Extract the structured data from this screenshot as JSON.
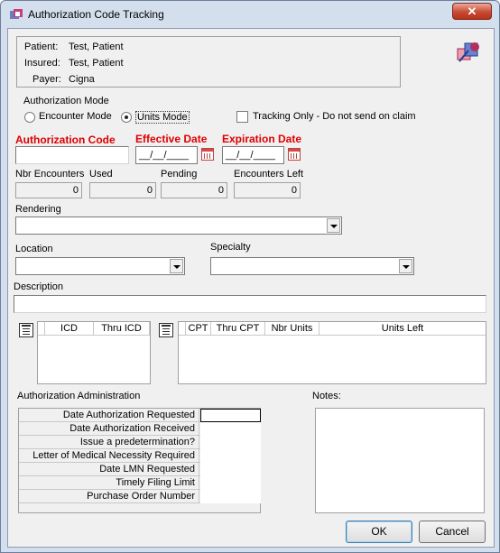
{
  "window": {
    "title": "Authorization Code Tracking",
    "close_symbol": "✕"
  },
  "patient_info": {
    "patient_label": "Patient:",
    "patient_value": "Test, Patient",
    "insured_label": "Insured:",
    "insured_value": "Test, Patient",
    "payer_label": "Payer:",
    "payer_value": "Cigna"
  },
  "auth_mode": {
    "group_label": "Authorization Mode",
    "encounter_label": "Encounter Mode",
    "units_label": "Units Mode",
    "selected": "Units Mode",
    "tracking_only_label": "Tracking Only - Do not send on claim",
    "tracking_only_checked": false
  },
  "fields": {
    "authorization_code_label": "Authorization Code",
    "authorization_code_value": "",
    "effective_date_label": "Effective Date",
    "effective_date_value": "__/__/____",
    "expiration_date_label": "Expiration Date",
    "expiration_date_value": "__/__/____"
  },
  "counts": {
    "nbr_encounters_label": "Nbr Encounters",
    "nbr_encounters_value": "0",
    "used_label": "Used",
    "used_value": "0",
    "pending_label": "Pending",
    "pending_value": "0",
    "encounters_left_label": "Encounters Left",
    "encounters_left_value": "0"
  },
  "rendering": {
    "label": "Rendering",
    "value": ""
  },
  "location": {
    "label": "Location",
    "value": ""
  },
  "specialty": {
    "label": "Specialty",
    "value": ""
  },
  "description": {
    "label": "Description",
    "value": ""
  },
  "icd_grid": {
    "columns": [
      "ICD",
      "Thru ICD"
    ]
  },
  "cpt_grid": {
    "columns": [
      "CPT",
      "Thru CPT",
      "Nbr Units",
      "Units Left"
    ]
  },
  "admin": {
    "label": "Authorization Administration",
    "rows": [
      "Date Authorization Requested",
      "Date Authorization Received",
      "Issue a predetermination?",
      "Letter of Medical Necessity Required",
      "Date LMN Requested",
      "Timely Filing Limit",
      "Purchase Order Number"
    ]
  },
  "notes": {
    "label": "Notes:",
    "value": ""
  },
  "buttons": {
    "ok": "OK",
    "cancel": "Cancel"
  },
  "colors": {
    "required_label": "#e00000",
    "window_frame": "#d4dfed",
    "close_button": "#c84a32"
  }
}
